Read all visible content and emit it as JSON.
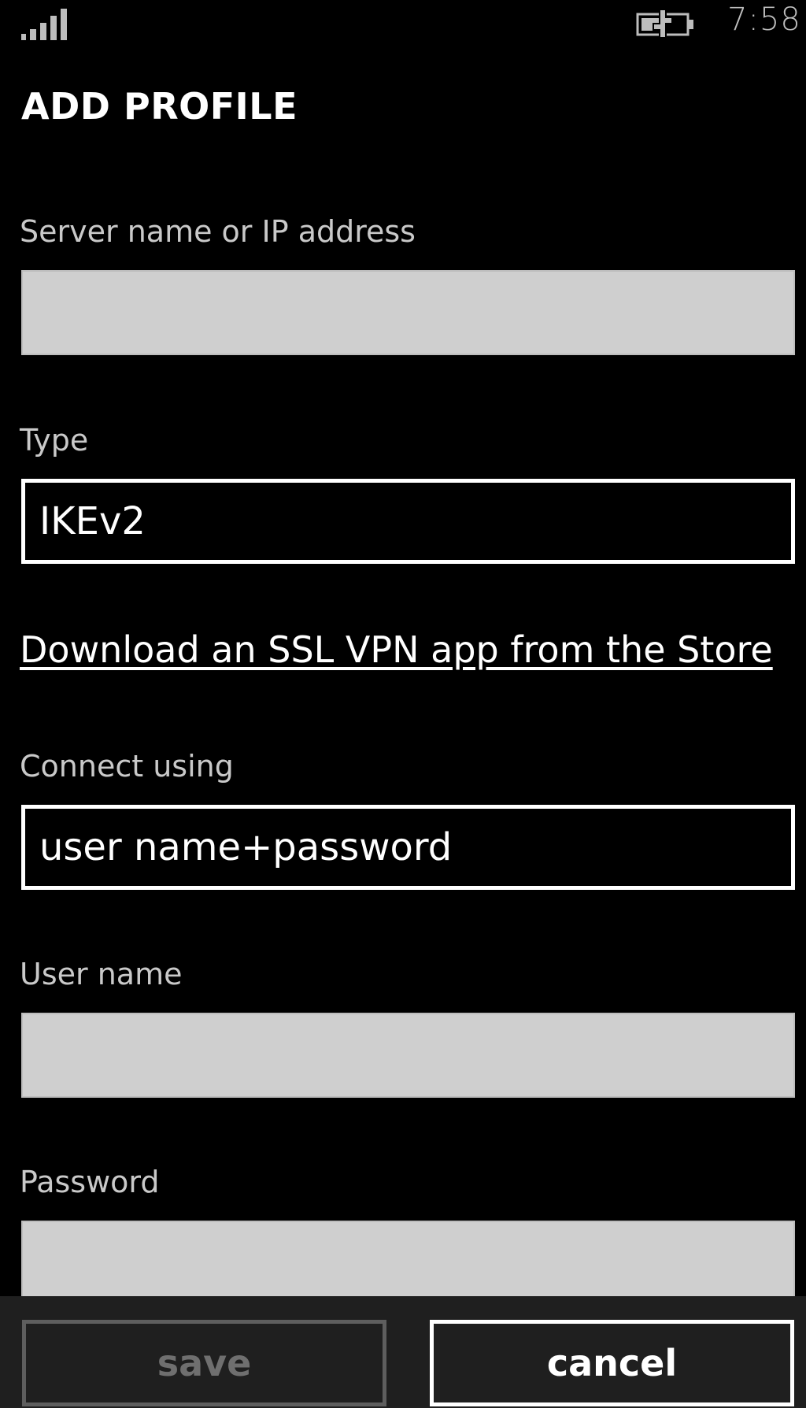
{
  "status_bar": {
    "signal_icon": "signal-strength-icon",
    "battery_icon": "battery-charging-icon",
    "time": "7:58"
  },
  "header": {
    "title": "ADD PROFILE"
  },
  "form": {
    "server": {
      "label": "Server name or IP address",
      "value": ""
    },
    "type": {
      "label": "Type",
      "value": "IKEv2"
    },
    "store_link": "Download an SSL VPN app from the Store",
    "connect_using": {
      "label": "Connect using",
      "value": "user name+password"
    },
    "user_name": {
      "label": "User name",
      "value": ""
    },
    "password": {
      "label": "Password",
      "value": ""
    }
  },
  "app_bar": {
    "save_label": "save",
    "cancel_label": "cancel"
  },
  "colors": {
    "background": "#000000",
    "input_fill": "#cfcfcf",
    "label_text": "#c9c9c9",
    "disabled_text": "#6f6f6f",
    "app_bar": "#1f1f1f"
  }
}
